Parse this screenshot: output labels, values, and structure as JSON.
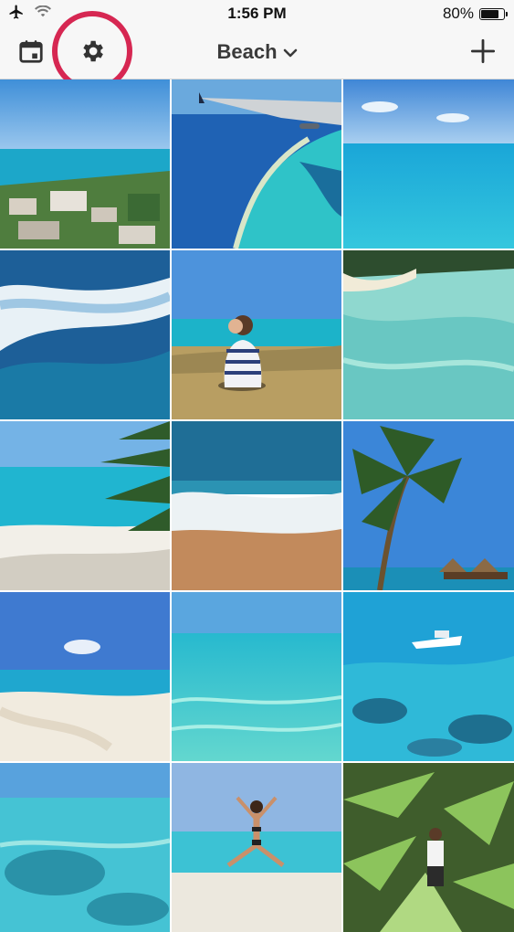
{
  "status_bar": {
    "time": "1:56 PM",
    "battery_text": "80%",
    "battery_level": 0.8,
    "icons": [
      "airplane-icon",
      "wifi-icon",
      "battery-icon"
    ]
  },
  "nav": {
    "left_icons": [
      "calendar-icon",
      "gear-icon"
    ],
    "title": "Beach",
    "title_icon": "chevron-down-icon",
    "right_icon": "plus-icon",
    "highlight_color": "#d62752"
  },
  "grid": {
    "columns": 3,
    "rows": 5,
    "photos": [
      "coastal-town-view",
      "airplane-wing-reef",
      "open-turquoise-sea",
      "ocean-waves",
      "woman-sitting-shore",
      "clear-shallow-water",
      "beach-with-palm",
      "waves-on-sand",
      "palm-tree-overwater-bungalows",
      "white-sand-beach",
      "turquoise-lagoon",
      "boat-over-reef",
      "shallow-reef-water",
      "woman-jumping-beach",
      "man-with-palms"
    ]
  },
  "colors": {
    "bar_bg": "#f7f7f7",
    "title_text": "#3a3a3a",
    "sea_turquoise": "#2cc4d2",
    "sky_blue": "#5a9fdc"
  }
}
